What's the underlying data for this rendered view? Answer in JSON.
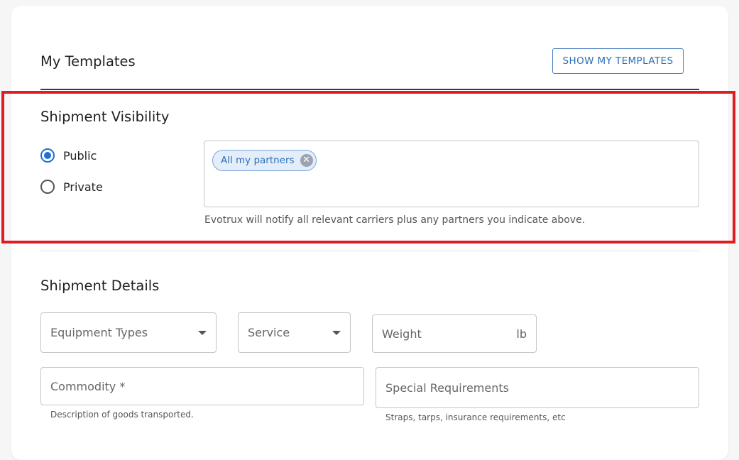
{
  "templates": {
    "title": "My Templates",
    "show_button": "SHOW MY TEMPLATES"
  },
  "visibility": {
    "title": "Shipment Visibility",
    "options": [
      {
        "label": "Public",
        "selected": true
      },
      {
        "label": "Private",
        "selected": false
      }
    ],
    "partners": {
      "chips": [
        "All my partners"
      ],
      "helper": "Evotrux will notify all relevant carriers plus any partners you indicate above."
    }
  },
  "details": {
    "title": "Shipment Details",
    "equipment_types": {
      "placeholder": "Equipment Types"
    },
    "service": {
      "placeholder": "Service"
    },
    "weight": {
      "placeholder": "Weight",
      "unit": "lb"
    },
    "commodity": {
      "placeholder": "Commodity *",
      "helper": "Description of goods transported."
    },
    "special_requirements": {
      "placeholder": "Special Requirements",
      "helper": "Straps, tarps, insurance requirements, etc"
    }
  },
  "colors": {
    "accent": "#1f6fd6",
    "highlight_border": "#e01b22",
    "chip_bg": "#e3eefa"
  }
}
